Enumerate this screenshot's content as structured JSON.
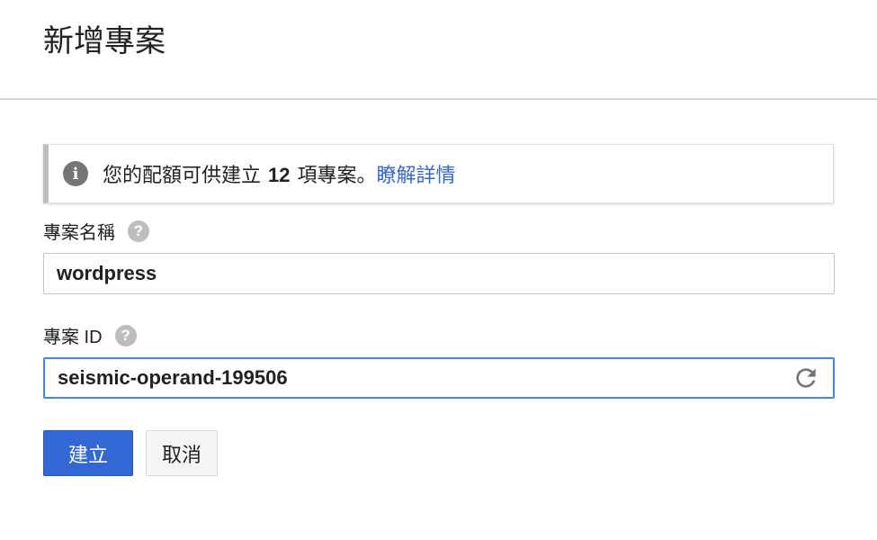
{
  "dialog": {
    "title": "新增專案"
  },
  "quota_notice": {
    "info_icon": "info-icon",
    "text_before": "您的配額可供建立",
    "count": "12",
    "text_after": "項專案。",
    "link_text": "瞭解詳情"
  },
  "project_name": {
    "label": "專案名稱",
    "help_icon": "help-icon",
    "value": "wordpress"
  },
  "project_id": {
    "label": "專案 ID",
    "help_icon": "help-icon",
    "value": "seismic-operand-199506",
    "refresh_icon": "refresh-icon"
  },
  "actions": {
    "create_label": "建立",
    "cancel_label": "取消"
  },
  "colors": {
    "primary": "#3367d6",
    "focus_border": "#4285f4",
    "link": "#3367d6"
  }
}
